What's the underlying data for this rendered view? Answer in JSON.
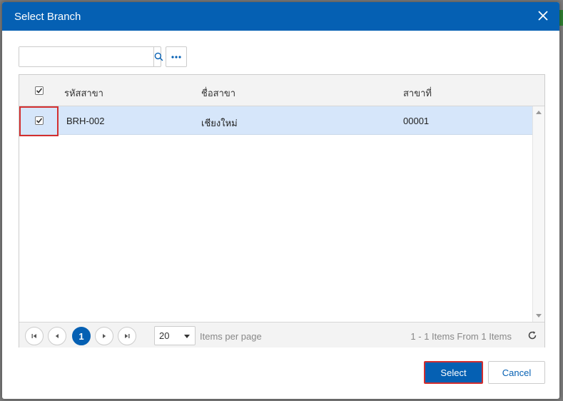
{
  "dialog": {
    "title": "Select Branch"
  },
  "search": {
    "value": "",
    "placeholder": ""
  },
  "grid": {
    "columns": [
      "รหัสสาขา",
      "ชื่อสาขา",
      "สาขาที่"
    ],
    "rows": [
      {
        "code": "BRH-002",
        "name": "เชียงใหม่",
        "branch_no": "00001",
        "checked": true
      }
    ]
  },
  "pager": {
    "current_page": "1",
    "page_size": "20",
    "items_per_page_label": "Items per page",
    "info": "1 - 1 Items From 1 Items"
  },
  "footer": {
    "select_label": "Select",
    "cancel_label": "Cancel"
  },
  "colors": {
    "primary": "#0560b3",
    "highlight": "#d32f2f",
    "selected_row": "#d6e6fa"
  }
}
